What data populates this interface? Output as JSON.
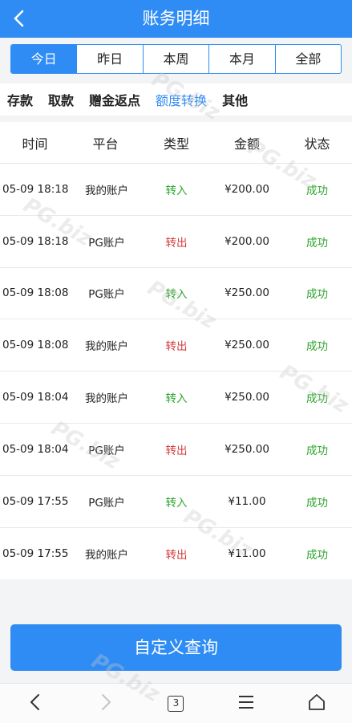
{
  "header": {
    "title": "账务明细"
  },
  "date_tabs": [
    {
      "label": "今日",
      "active": true
    },
    {
      "label": "昨日",
      "active": false
    },
    {
      "label": "本周",
      "active": false
    },
    {
      "label": "本月",
      "active": false
    },
    {
      "label": "全部",
      "active": false
    }
  ],
  "type_tabs": [
    {
      "label": "存款",
      "active": false
    },
    {
      "label": "取款",
      "active": false
    },
    {
      "label": "赠金返点",
      "active": false
    },
    {
      "label": "额度转换",
      "active": true
    },
    {
      "label": "其他",
      "active": false
    }
  ],
  "table": {
    "headers": [
      "时间",
      "平台",
      "类型",
      "金额",
      "状态"
    ],
    "rows": [
      {
        "time": "05-09 18:18",
        "platform": "我的账户",
        "type": "转入",
        "amount": "¥200.00",
        "status": "成功"
      },
      {
        "time": "05-09 18:18",
        "platform": "PG账户",
        "type": "转出",
        "amount": "¥200.00",
        "status": "成功"
      },
      {
        "time": "05-09 18:08",
        "platform": "PG账户",
        "type": "转入",
        "amount": "¥250.00",
        "status": "成功"
      },
      {
        "time": "05-09 18:08",
        "platform": "我的账户",
        "type": "转出",
        "amount": "¥250.00",
        "status": "成功"
      },
      {
        "time": "05-09 18:04",
        "platform": "我的账户",
        "type": "转入",
        "amount": "¥250.00",
        "status": "成功"
      },
      {
        "time": "05-09 18:04",
        "platform": "PG账户",
        "type": "转出",
        "amount": "¥250.00",
        "status": "成功"
      },
      {
        "time": "05-09 17:55",
        "platform": "PG账户",
        "type": "转入",
        "amount": "¥11.00",
        "status": "成功"
      },
      {
        "time": "05-09 17:55",
        "platform": "我的账户",
        "type": "转出",
        "amount": "¥11.00",
        "status": "成功"
      }
    ]
  },
  "query_button": {
    "label": "自定义查询"
  },
  "browser_nav": {
    "tab_count": "3",
    "icons": [
      "back-icon",
      "forward-icon",
      "tabs-icon",
      "menu-icon",
      "home-icon"
    ]
  },
  "watermark": {
    "text": "PG.biz"
  },
  "colors": {
    "brand": "#2f8cf5",
    "transfer_in": "#2aa52a",
    "transfer_out": "#d63a3a",
    "success": "#2aa52a"
  }
}
